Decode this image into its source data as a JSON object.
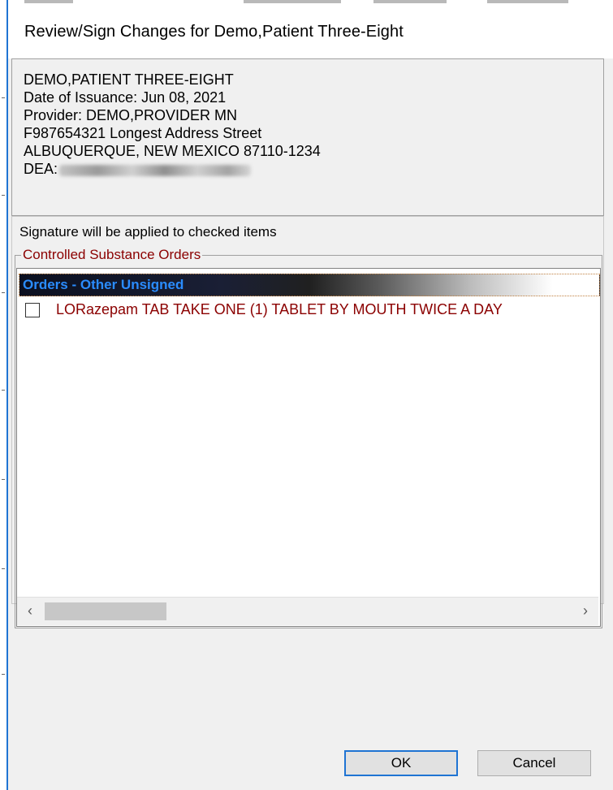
{
  "dialog": {
    "title": "Review/Sign Changes for Demo,Patient Three-Eight"
  },
  "patient_info": {
    "name": "DEMO,PATIENT THREE-EIGHT",
    "issuance": "Date of Issuance: Jun 08, 2021",
    "provider": "Provider: DEMO,PROVIDER MN",
    "address": "F987654321 Longest Address Street",
    "city": "ALBUQUERQUE, NEW MEXICO  87110-1234",
    "dea_label": "DEA:"
  },
  "signature_note": "Signature will be applied to checked items",
  "orders_section": {
    "label": "Controlled Substance Orders",
    "group_header": "Orders - Other Unsigned",
    "items": [
      {
        "text": "LORazepam TAB  TAKE ONE (1) TABLET BY MOUTH TWICE A DAY",
        "checked": false
      }
    ]
  },
  "scrollbar": {
    "left_icon": "chevron-left-icon",
    "right_icon": "chevron-right-icon"
  },
  "buttons": {
    "ok": "OK",
    "cancel": "Cancel"
  },
  "colors": {
    "accent": "#1f74d3",
    "order_text": "#8b0000",
    "group_header_text": "#2a8cff"
  }
}
